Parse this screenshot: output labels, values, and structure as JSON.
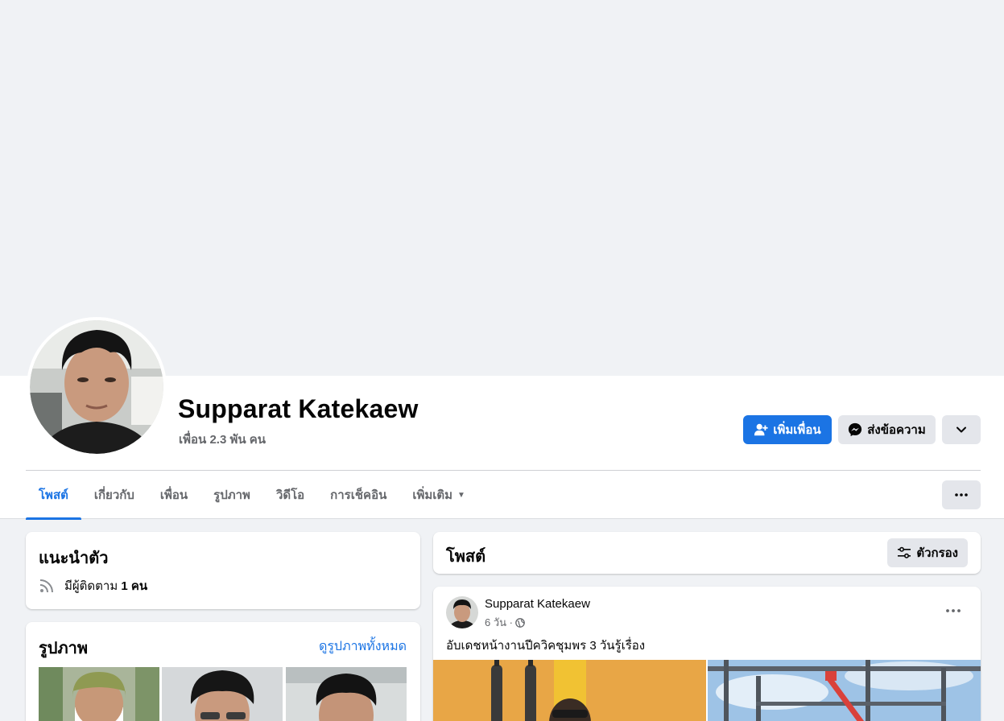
{
  "profile": {
    "name": "Supparat Katekaew",
    "friends": "เพื่อน 2.3 พัน คน"
  },
  "actions": {
    "add_friend": "เพิ่มเพื่อน",
    "message": "ส่งข้อความ"
  },
  "tabs": [
    {
      "label": "โพสต์"
    },
    {
      "label": "เกี่ยวกับ"
    },
    {
      "label": "เพื่อน"
    },
    {
      "label": "รูปภาพ"
    },
    {
      "label": "วิดีโอ"
    },
    {
      "label": "การเช็คอิน"
    },
    {
      "label": "เพิ่มเติม"
    }
  ],
  "intro": {
    "title": "แนะนำตัว",
    "followers_prefix": "มีผู้ติดตาม",
    "followers_count": "1 คน"
  },
  "photos": {
    "title": "รูปภาพ",
    "see_all": "ดูรูปภาพทั้งหมด"
  },
  "posts": {
    "title": "โพสต์",
    "filter": "ตัวกรอง"
  },
  "post": {
    "author": "Supparat Katekaew",
    "time": "6 วัน ·",
    "text": "อับเดชหน้างานปีควิคชุมพร 3 วันรู้เรื่อง"
  },
  "colors": {
    "accent": "#1b74e4",
    "background": "#f0f2f5",
    "secondary_button": "#e4e6eb",
    "muted_text": "#65676b"
  },
  "icons": {
    "add_friend": "person-plus-icon",
    "message": "messenger-icon",
    "dropdown": "chevron-down-icon",
    "more": "ellipsis-icon",
    "rss": "rss-icon",
    "filter": "sliders-icon",
    "privacy": "globe-icon"
  }
}
